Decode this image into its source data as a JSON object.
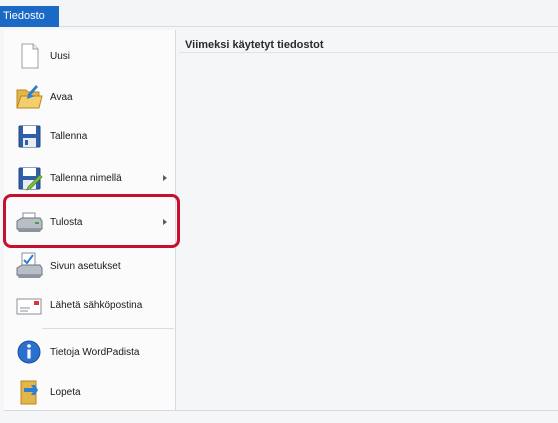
{
  "menu": {
    "tab_label": "Tiedosto",
    "items": [
      {
        "label": "Uusi"
      },
      {
        "label": "Avaa"
      },
      {
        "label": "Tallenna"
      },
      {
        "label": "Tallenna nimellä"
      },
      {
        "label": "Tulosta"
      },
      {
        "label": "Sivun asetukset"
      },
      {
        "label": "Lähetä sähköpostina"
      },
      {
        "label": "Tietoja WordPadista"
      },
      {
        "label": "Lopeta"
      }
    ]
  },
  "recent": {
    "title": "Viimeksi käytetyt tiedostot"
  },
  "colors": {
    "file_tab": "#1a69c4",
    "highlight": "#c8102e"
  }
}
